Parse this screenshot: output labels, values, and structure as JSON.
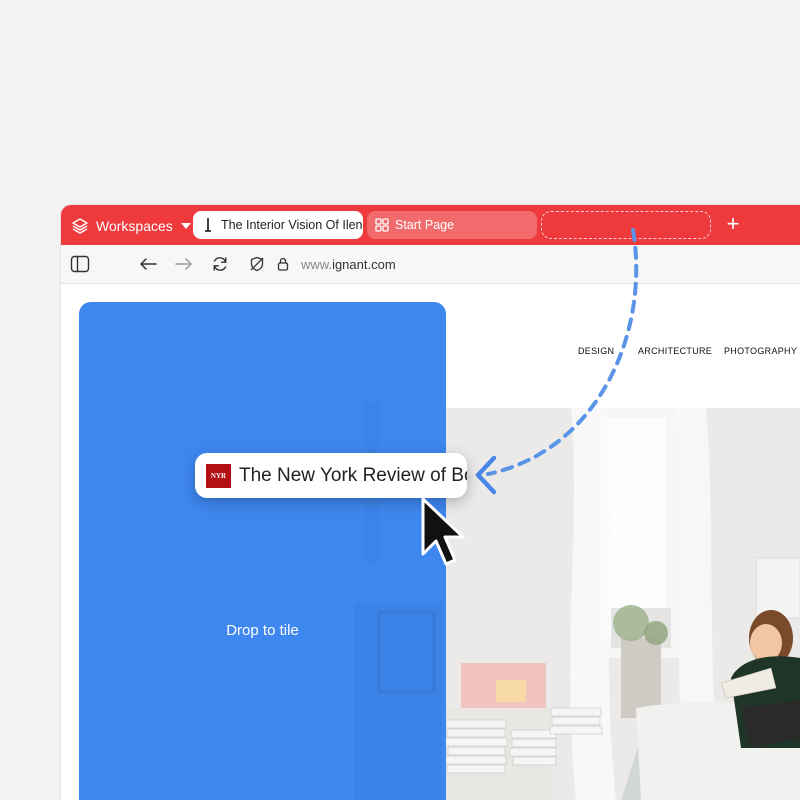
{
  "tabbar": {
    "workspaces_label": "Workspaces",
    "active_tab_title": "The Interior Vision Of Ilenia",
    "start_tab_title": "Start Page",
    "new_tab_symbol": "+",
    "color": "#ef3a3d"
  },
  "toolbar": {
    "address_prefix": "www.",
    "address_domain": "ignant.com"
  },
  "site": {
    "nav": [
      "DESIGN",
      "ARCHITECTURE",
      "PHOTOGRAPHY"
    ]
  },
  "tile": {
    "label": "Drop to tile",
    "color": "#3e87ef"
  },
  "drag": {
    "favicon_text": "NYR",
    "title": "The New York Review of Books"
  },
  "icons": [
    "workspaces-icon",
    "sidebar-toggle-icon",
    "back-icon",
    "forward-icon",
    "reload-icon",
    "shield-off-icon",
    "lock-icon",
    "grid-icon",
    "cursor-icon"
  ]
}
